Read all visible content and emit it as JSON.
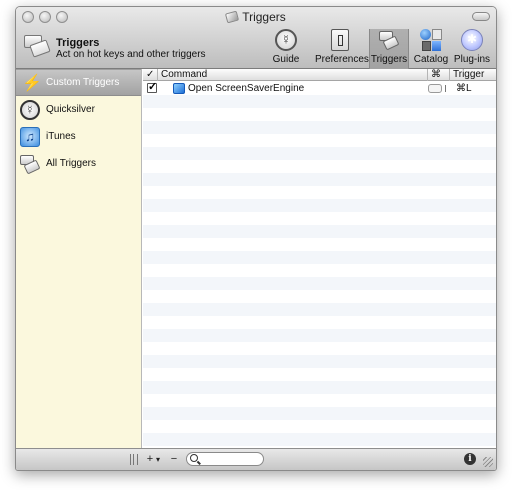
{
  "window": {
    "title": "Triggers"
  },
  "header": {
    "title": "Triggers",
    "subtitle": "Act on hot keys and other triggers"
  },
  "toolbar": {
    "items": [
      {
        "label": "Guide",
        "icon": "guide-icon"
      },
      {
        "label": "Preferences",
        "icon": "preferences-icon"
      },
      {
        "label": "Triggers",
        "icon": "triggers-icon",
        "active": true
      },
      {
        "label": "Catalog",
        "icon": "catalog-icon"
      },
      {
        "label": "Plug-ins",
        "icon": "plugins-icon"
      }
    ]
  },
  "sidebar": {
    "items": [
      {
        "label": "Custom Triggers",
        "icon": "lightning-icon",
        "selected": true
      },
      {
        "label": "Quicksilver",
        "icon": "quicksilver-icon"
      },
      {
        "label": "iTunes",
        "icon": "itunes-icon"
      },
      {
        "label": "All Triggers",
        "icon": "triggers-icon"
      }
    ]
  },
  "table": {
    "columns": {
      "enabled": "✓",
      "command": "Command",
      "key": "⌘",
      "trigger": "Trigger"
    },
    "rows": [
      {
        "enabled": true,
        "command": "Open ScreenSaverEngine",
        "trigger": "⌘L"
      }
    ]
  },
  "bottombar": {
    "add_label": "+",
    "add_menu": "▾",
    "remove_label": "−",
    "search_value": "",
    "info_label": "i"
  }
}
